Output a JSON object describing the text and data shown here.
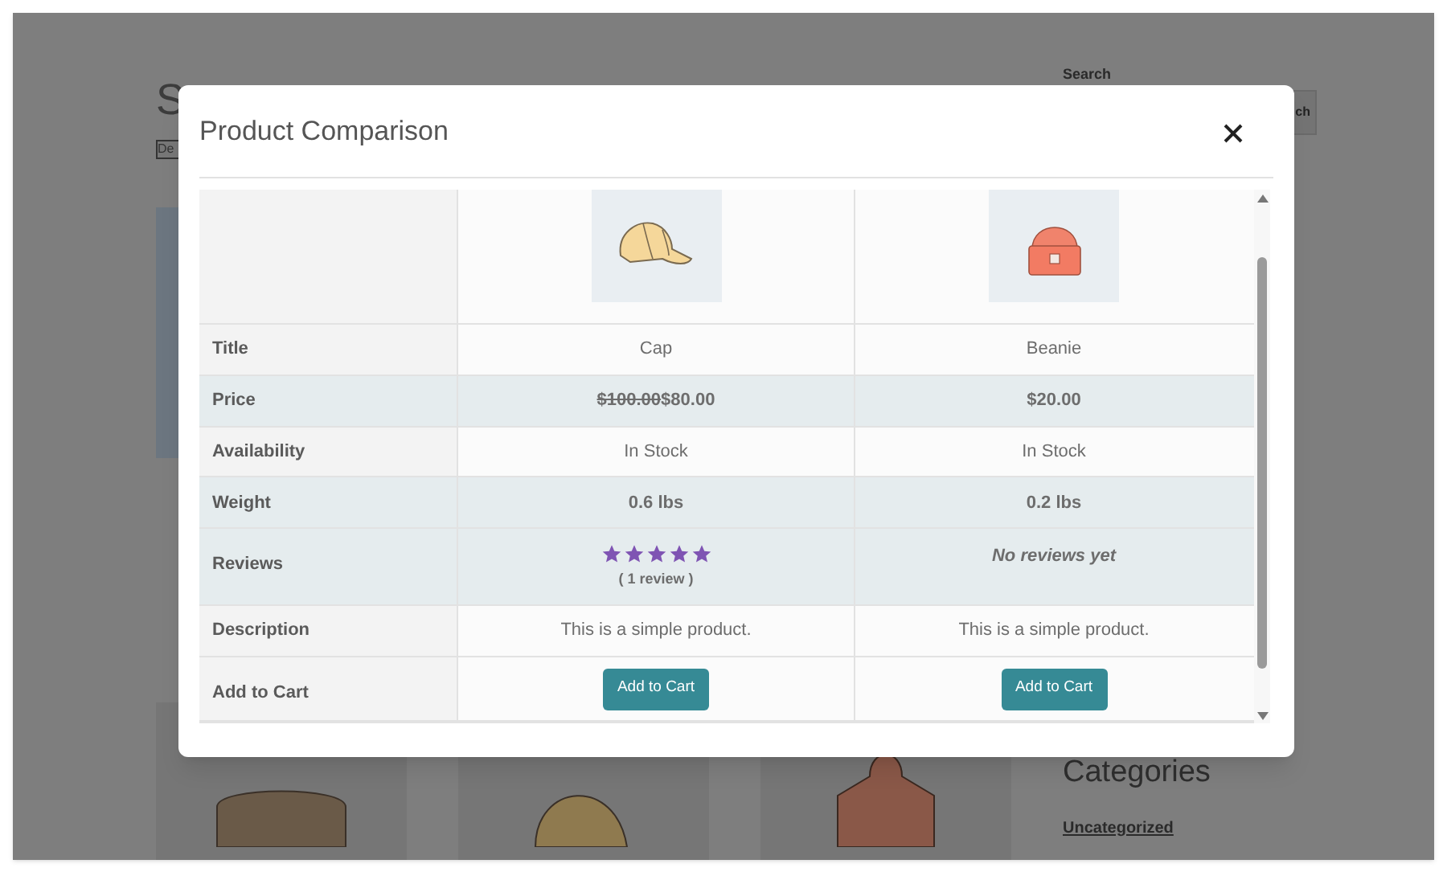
{
  "page": {
    "heading": "S",
    "select": "De",
    "search_label": "Search",
    "search_button": "ch",
    "categories_heading": "Categories",
    "category_link": "Uncategorized"
  },
  "modal": {
    "title": "Product Comparison"
  },
  "rows": [
    {
      "kind": "figure",
      "label": "",
      "shaded": false,
      "cells": [
        {
          "kind": "cap"
        },
        {
          "kind": "beanie"
        }
      ]
    },
    {
      "kind": "text",
      "label": "Title",
      "shaded": false,
      "cells": [
        {
          "text": "Cap"
        },
        {
          "text": "Beanie"
        }
      ]
    },
    {
      "kind": "price",
      "label": "Price",
      "shaded": true,
      "cells": [
        {
          "old": "$100.00",
          "price": "$80.00"
        },
        {
          "price": "$20.00"
        }
      ]
    },
    {
      "kind": "text",
      "label": "Availability",
      "shaded": false,
      "cells": [
        {
          "text": "In Stock"
        },
        {
          "text": "In Stock"
        }
      ]
    },
    {
      "kind": "measure",
      "label": "Weight",
      "shaded": true,
      "cells": [
        {
          "text": "0.6 lbs"
        },
        {
          "text": "0.2 lbs"
        }
      ]
    },
    {
      "kind": "reviews",
      "label": "Reviews",
      "shaded": true,
      "cells": [
        {
          "stars": 5,
          "count": "( 1 review )"
        },
        {
          "text": "No reviews yet"
        }
      ]
    },
    {
      "kind": "text",
      "label": "Description",
      "shaded": false,
      "cells": [
        {
          "text": "This is a simple product."
        },
        {
          "text": "This is a simple product."
        }
      ]
    },
    {
      "kind": "button",
      "label": "Add to Cart",
      "shaded": false,
      "cells": [
        {
          "text": "Add to Cart"
        },
        {
          "text": "Add to Cart"
        }
      ]
    }
  ]
}
